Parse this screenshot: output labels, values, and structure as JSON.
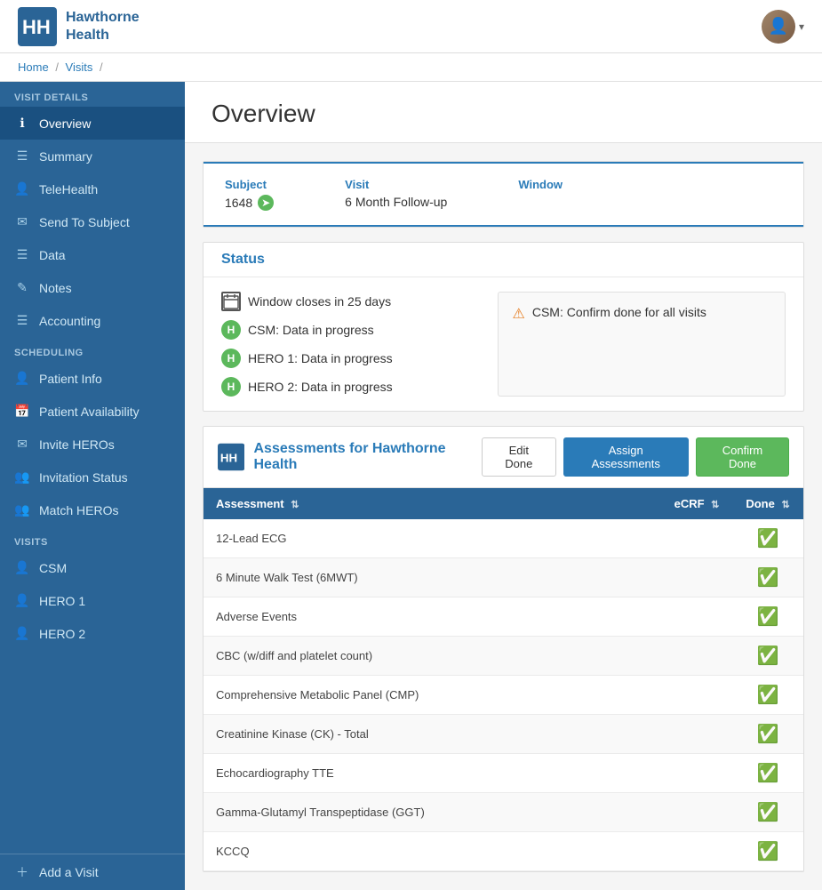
{
  "app": {
    "name_line1": "Hawthorne",
    "name_line2": "Health"
  },
  "breadcrumb": {
    "home": "Home",
    "visits": "Visits"
  },
  "sidebar": {
    "section_visit_details": "VISIT DETAILS",
    "section_scheduling": "SCHEDULING",
    "section_visits": "VISITS",
    "items": [
      {
        "id": "overview",
        "label": "Overview",
        "icon": "ℹ",
        "active": true
      },
      {
        "id": "summary",
        "label": "Summary",
        "icon": "☰",
        "active": false
      },
      {
        "id": "telehealth",
        "label": "TeleHealth",
        "icon": "👤",
        "active": false
      },
      {
        "id": "send-to-subject",
        "label": "Send To Subject",
        "icon": "✉",
        "active": false
      },
      {
        "id": "data",
        "label": "Data",
        "icon": "☰",
        "active": false
      },
      {
        "id": "notes",
        "label": "Notes",
        "icon": "✎",
        "active": false
      },
      {
        "id": "accounting",
        "label": "Accounting",
        "icon": "☰",
        "active": false
      },
      {
        "id": "patient-info",
        "label": "Patient Info",
        "icon": "👤",
        "active": false
      },
      {
        "id": "patient-availability",
        "label": "Patient Availability",
        "icon": "📅",
        "active": false
      },
      {
        "id": "invite-heros",
        "label": "Invite HEROs",
        "icon": "✉",
        "active": false
      },
      {
        "id": "invitation-status",
        "label": "Invitation Status",
        "icon": "👥",
        "active": false
      },
      {
        "id": "match-heros",
        "label": "Match HEROs",
        "icon": "👥",
        "active": false
      },
      {
        "id": "csm",
        "label": "CSM",
        "icon": "👤",
        "active": false
      },
      {
        "id": "hero1",
        "label": "HERO 1",
        "icon": "👤",
        "active": false
      },
      {
        "id": "hero2",
        "label": "HERO 2",
        "icon": "👤",
        "active": false
      }
    ],
    "add_visit": "Add a Visit"
  },
  "main": {
    "page_title": "Overview",
    "subject_label": "Subject",
    "subject_value": "1648",
    "visit_label": "Visit",
    "visit_value": "6 Month Follow-up",
    "window_label": "Window",
    "window_value": "",
    "status_section_label": "Status",
    "status_window": "Window closes in 25 days",
    "status_csm": "CSM: Data in progress",
    "status_hero1": "HERO 1: Data in progress",
    "status_hero2": "HERO 2: Data in progress",
    "status_warning": "CSM: Confirm done for all visits",
    "assessments_title": "Assessments for Hawthorne Health",
    "btn_edit_done": "Edit Done",
    "btn_assign": "Assign Assessments",
    "btn_confirm": "Confirm Done",
    "table": {
      "col_assessment": "Assessment",
      "col_ecrf": "eCRF",
      "col_done": "Done",
      "rows": [
        {
          "assessment": "12-Lead ECG",
          "ecrf": "",
          "done": true
        },
        {
          "assessment": "6 Minute Walk Test (6MWT)",
          "ecrf": "",
          "done": true
        },
        {
          "assessment": "Adverse Events",
          "ecrf": "",
          "done": true
        },
        {
          "assessment": "CBC (w/diff and platelet count)",
          "ecrf": "",
          "done": true
        },
        {
          "assessment": "Comprehensive Metabolic Panel (CMP)",
          "ecrf": "",
          "done": true
        },
        {
          "assessment": "Creatinine Kinase (CK) - Total",
          "ecrf": "",
          "done": true
        },
        {
          "assessment": "Echocardiography TTE",
          "ecrf": "",
          "done": true
        },
        {
          "assessment": "Gamma-Glutamyl Transpeptidase (GGT)",
          "ecrf": "",
          "done": true
        },
        {
          "assessment": "KCCQ",
          "ecrf": "",
          "done": true
        }
      ]
    }
  }
}
